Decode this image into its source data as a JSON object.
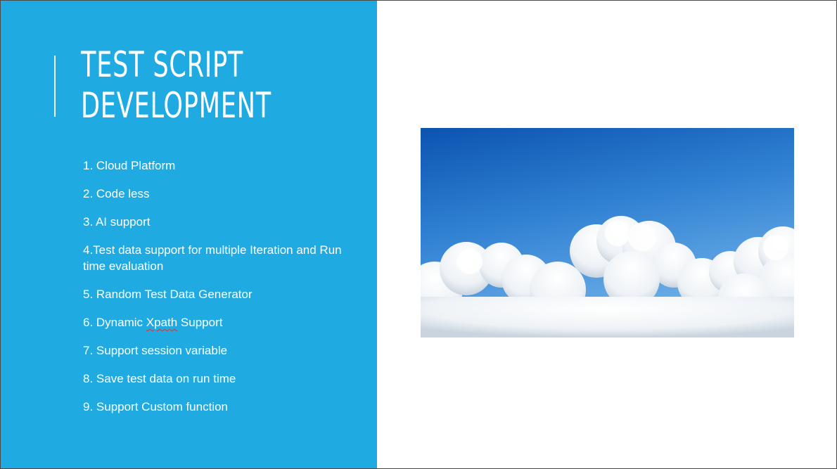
{
  "slide": {
    "title_lines": [
      "TEST SCRIPT",
      "DEVELOPMENT"
    ],
    "features": [
      "1. Cloud Platform",
      "2. Code less",
      "3. AI support",
      "4.Test data support for multiple Iteration and Run  time evaluation",
      "5. Random Test Data Generator",
      {
        "before": "6. Dynamic ",
        "flagged": "Xpath",
        "after": " Support"
      },
      "7. Support session variable",
      "8. Save test data on run time",
      "9. Support Custom function"
    ]
  },
  "colors": {
    "panel": "#1fabe2",
    "text": "#ffffff",
    "spellcheck": "#e0302a"
  },
  "image": {
    "icon": "sky-clouds-photo"
  }
}
